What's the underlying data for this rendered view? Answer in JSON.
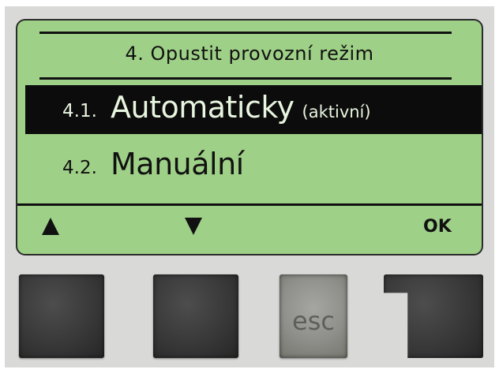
{
  "screen": {
    "title": "4. Opustit provozní režim",
    "items": [
      {
        "number": "4.1.",
        "label": "Automaticky",
        "tag": "(aktivní)",
        "selected": true
      },
      {
        "number": "4.2.",
        "label": "Manuální",
        "tag": "",
        "selected": false
      }
    ]
  },
  "footer": {
    "up_icon": "triangle-up-icon",
    "down_icon": "triangle-down-icon",
    "ok_label": "OK"
  },
  "buttons": {
    "esc_label": "esc"
  },
  "colors": {
    "lcd_background": "#9ed087",
    "selection_background": "#0c0c0c",
    "device_frame": "#d9d9d7",
    "button_dark": "#3a3a3a",
    "button_esc": "#8e8e8a"
  }
}
